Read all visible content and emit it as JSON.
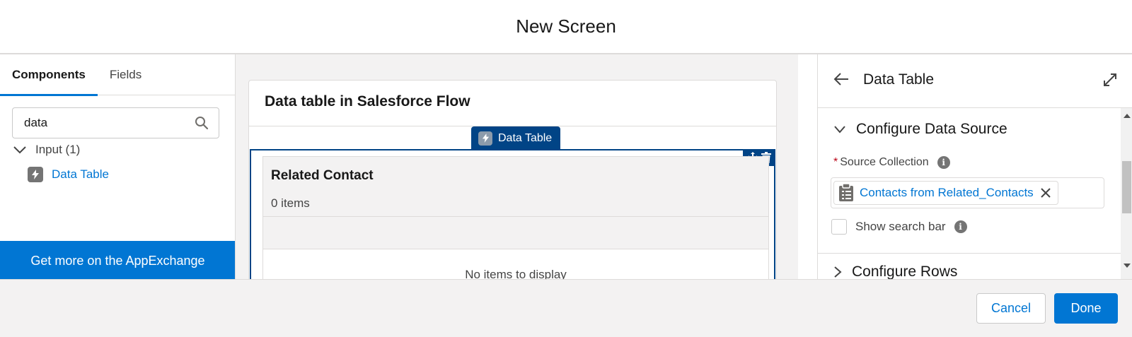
{
  "modal": {
    "title": "New Screen"
  },
  "left_panel": {
    "tabs": [
      {
        "label": "Components",
        "active": true
      },
      {
        "label": "Fields",
        "active": false
      }
    ],
    "search": {
      "value": "data",
      "icon": "search-icon"
    },
    "group": {
      "label": "Input (1)"
    },
    "items": [
      {
        "label": "Data Table",
        "icon": "bolt-icon"
      }
    ],
    "appexchange_label": "Get more on the AppExchange"
  },
  "canvas": {
    "screen_title": "Data table in Salesforce Flow",
    "component_badge": "Data Table",
    "table": {
      "title": "Related Contact",
      "count": "0 items",
      "empty_text": "No items to display"
    }
  },
  "right_panel": {
    "title": "Data Table",
    "section": {
      "label": "Configure Data Source",
      "expanded": true
    },
    "source_collection": {
      "label": "Source Collection",
      "required": true,
      "value": "Contacts from Related_Contacts"
    },
    "show_search_bar": {
      "label": "Show search bar",
      "checked": false
    },
    "next_section": {
      "label": "Configure Rows",
      "expanded": false
    }
  },
  "footer": {
    "cancel_label": "Cancel",
    "done_label": "Done"
  },
  "colors": {
    "brand": "#0176d3",
    "badge_navy": "#014486",
    "required": "#ba0517"
  }
}
